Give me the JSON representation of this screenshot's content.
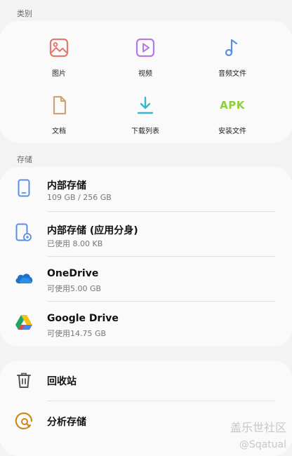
{
  "sections": {
    "categories_title": "类别",
    "storage_title": "存储"
  },
  "categories": [
    {
      "label": "图片",
      "icon": "image-icon",
      "color": "#e37b6f"
    },
    {
      "label": "视频",
      "icon": "video-icon",
      "color": "#b27be6"
    },
    {
      "label": "音频文件",
      "icon": "music-icon",
      "color": "#5a8fe0"
    },
    {
      "label": "文档",
      "icon": "document-icon",
      "color": "#c9a67a"
    },
    {
      "label": "下载列表",
      "icon": "download-icon",
      "color": "#35b8c9"
    },
    {
      "label": "安装文件",
      "icon": "apk-icon",
      "text": "APK",
      "color": "#8fcf3c"
    }
  ],
  "storage": [
    {
      "title": "内部存储",
      "subtitle": "109 GB / 256 GB",
      "icon": "phone-icon"
    },
    {
      "title": "内部存储 (应用分身)",
      "subtitle": "已使用 8.00 KB",
      "icon": "dual-app-phone-icon"
    },
    {
      "title": "OneDrive",
      "subtitle": "可使用5.00 GB",
      "icon": "onedrive-icon"
    },
    {
      "title": "Google Drive",
      "subtitle": "可使用14.75 GB",
      "icon": "google-drive-icon"
    }
  ],
  "utilities": [
    {
      "title": "回收站",
      "icon": "trash-icon"
    },
    {
      "title": "分析存储",
      "icon": "analyze-storage-icon"
    }
  ],
  "watermark": {
    "line1": "盖乐世社区",
    "line2": "@Sqatual"
  }
}
